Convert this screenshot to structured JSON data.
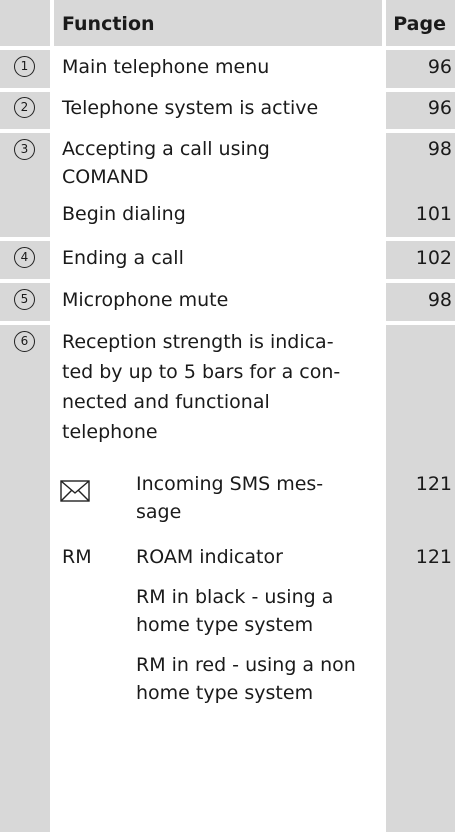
{
  "header": {
    "function_label": "Function",
    "page_label": "Page"
  },
  "rows": [
    {
      "num": "1",
      "lines": [
        "Main telephone menu"
      ],
      "page": "96"
    },
    {
      "num": "2",
      "lines": [
        "Telephone system is active"
      ],
      "page": "96"
    },
    {
      "num": "3",
      "lines": [
        "Accepting a call using",
        "COMAND"
      ],
      "page": "98",
      "extra": {
        "text": "Begin dialing",
        "page": "101"
      }
    },
    {
      "num": "4",
      "lines": [
        "Ending a call"
      ],
      "page": "102"
    },
    {
      "num": "5",
      "lines": [
        "Microphone mute"
      ],
      "page": "98"
    },
    {
      "num": "6",
      "lines": [
        "Reception strength is indica-",
        "ted by up to 5 bars for a con-",
        "nected and functional",
        "telephone"
      ]
    }
  ],
  "sub_items": [
    {
      "icon": "envelope-icon",
      "lines": [
        "Incoming SMS mes-",
        "sage"
      ],
      "page": "121"
    },
    {
      "symbol": "RM",
      "lines": [
        "ROAM indicator"
      ],
      "page": "121"
    },
    {
      "lines": [
        "RM in black - using a",
        "home type system"
      ]
    },
    {
      "lines": [
        "RM in red - using a non",
        "home type system"
      ]
    }
  ]
}
